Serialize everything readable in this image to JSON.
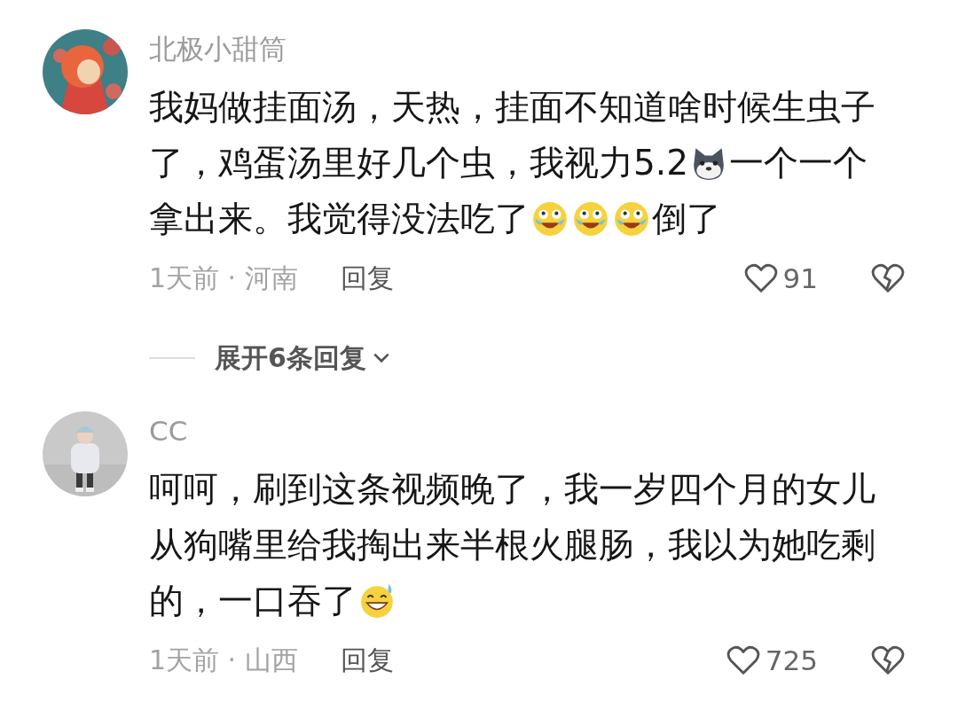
{
  "comments": [
    {
      "user": "北极小甜筒",
      "avatar": {
        "kind": "picture"
      },
      "lines": [
        [
          {
            "kind": "text",
            "text": "我妈做挂面汤，天热，挂面不知道啥时候生虫子"
          }
        ],
        [
          {
            "kind": "text",
            "text": "了，鸡蛋汤里好几个虫，我视力5.2"
          },
          {
            "kind": "dog"
          },
          {
            "kind": "text",
            "text": "一个一个"
          }
        ],
        [
          {
            "kind": "text",
            "text": "拿出来。我觉得没法吃了"
          },
          {
            "kind": "crying"
          },
          {
            "kind": "crying"
          },
          {
            "kind": "crying"
          },
          {
            "kind": "text",
            "text": "倒了"
          }
        ]
      ],
      "meta": "1天前 · 河南",
      "reply": "回复",
      "likes": "91",
      "expand": "展开6条回复"
    },
    {
      "user": "CC",
      "avatar": {
        "kind": "picture"
      },
      "lines": [
        [
          {
            "kind": "text",
            "text": "呵呵，刷到这条视频晚了，我一岁四个月的女儿"
          }
        ],
        [
          {
            "kind": "text",
            "text": "从狗嘴里给我掏出来半根火腿肠，我以为她吃剩"
          }
        ],
        [
          {
            "kind": "text",
            "text": "的，一口吞了"
          },
          {
            "kind": "sweat"
          }
        ]
      ],
      "meta": "1天前 · 山西",
      "reply": "回复",
      "likes": "725"
    }
  ]
}
